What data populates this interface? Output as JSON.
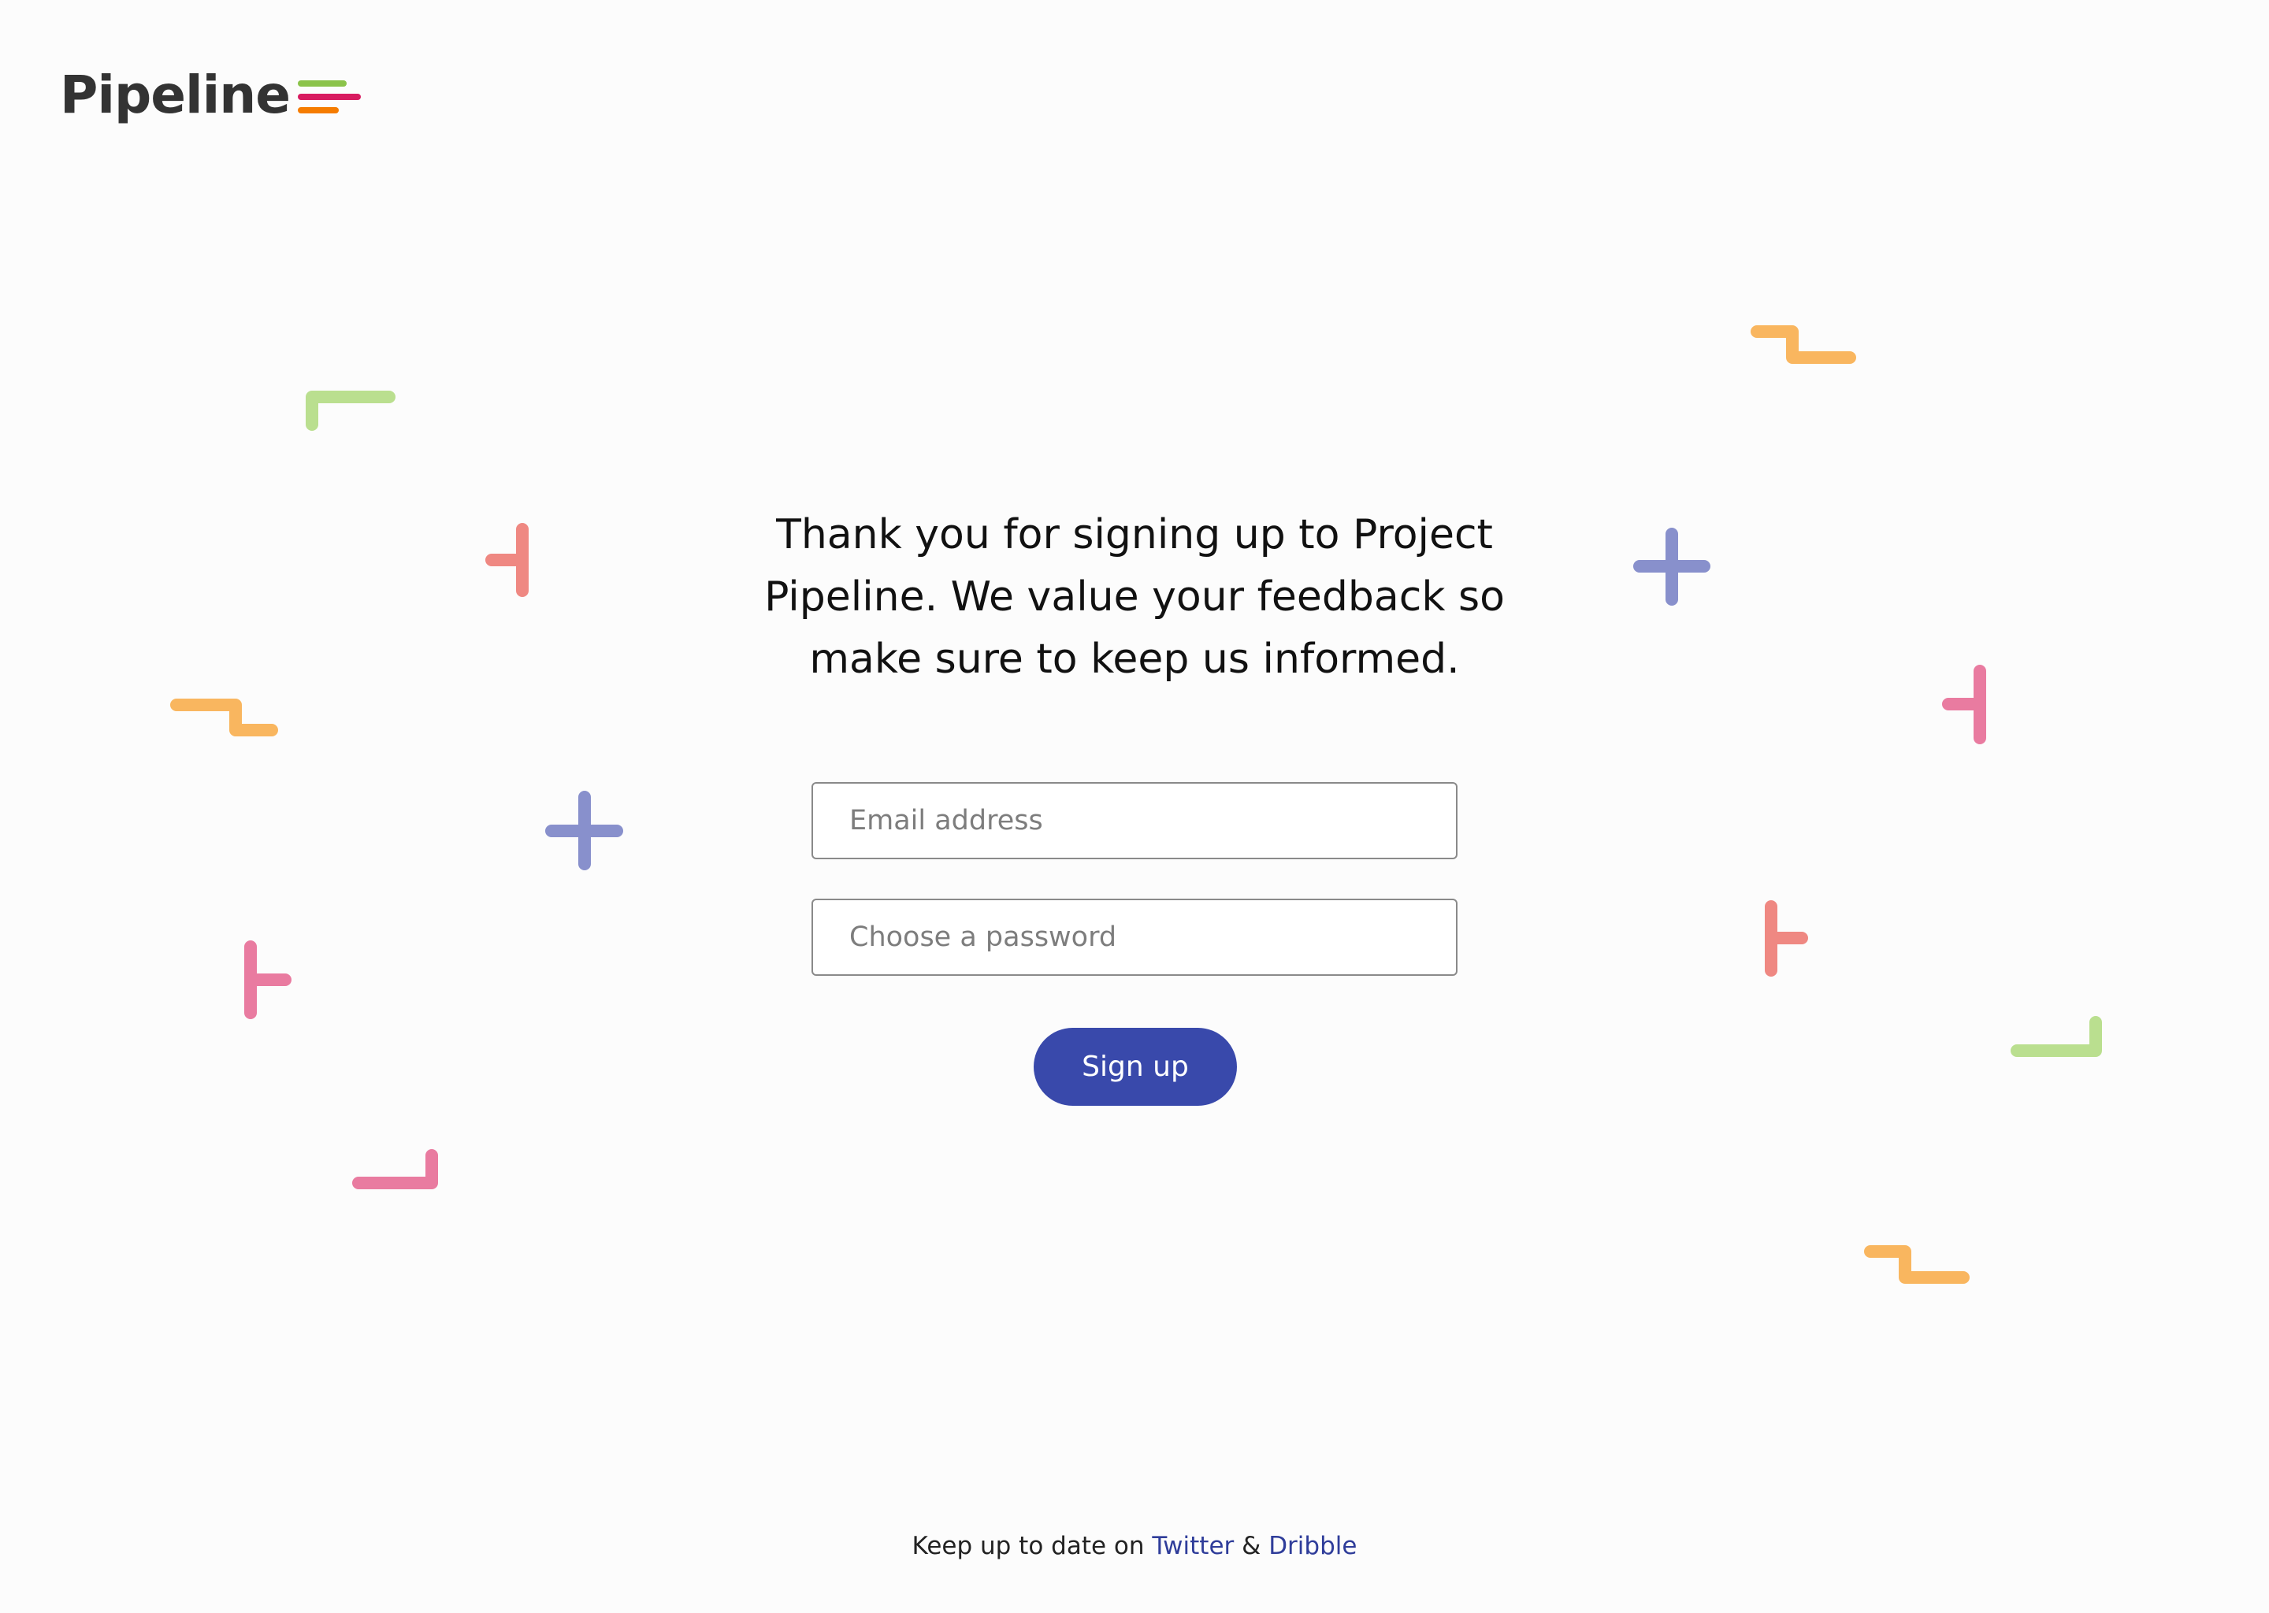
{
  "brand": {
    "name": "Pipeline",
    "bar_colors": [
      "#8bc34a",
      "#d81b60",
      "#f57c00"
    ]
  },
  "main": {
    "heading": "Thank you for signing up to Project Pipeline. We value your feedback so make sure to keep us informed.",
    "email": {
      "placeholder": "Email address",
      "value": ""
    },
    "password": {
      "placeholder": "Choose a password",
      "value": ""
    },
    "signup_label": "Sign up",
    "accent_color": "#3949ab"
  },
  "footer": {
    "prefix": "Keep up to date on",
    "twitter_label": "Twitter",
    "separator": "&",
    "dribble_label": "Dribble"
  },
  "decoration_colors": {
    "green": "#badf8f",
    "orange": "#f9b65f",
    "salmon": "#ef8882",
    "pink": "#e97ba0",
    "indigo": "#8890cc"
  }
}
